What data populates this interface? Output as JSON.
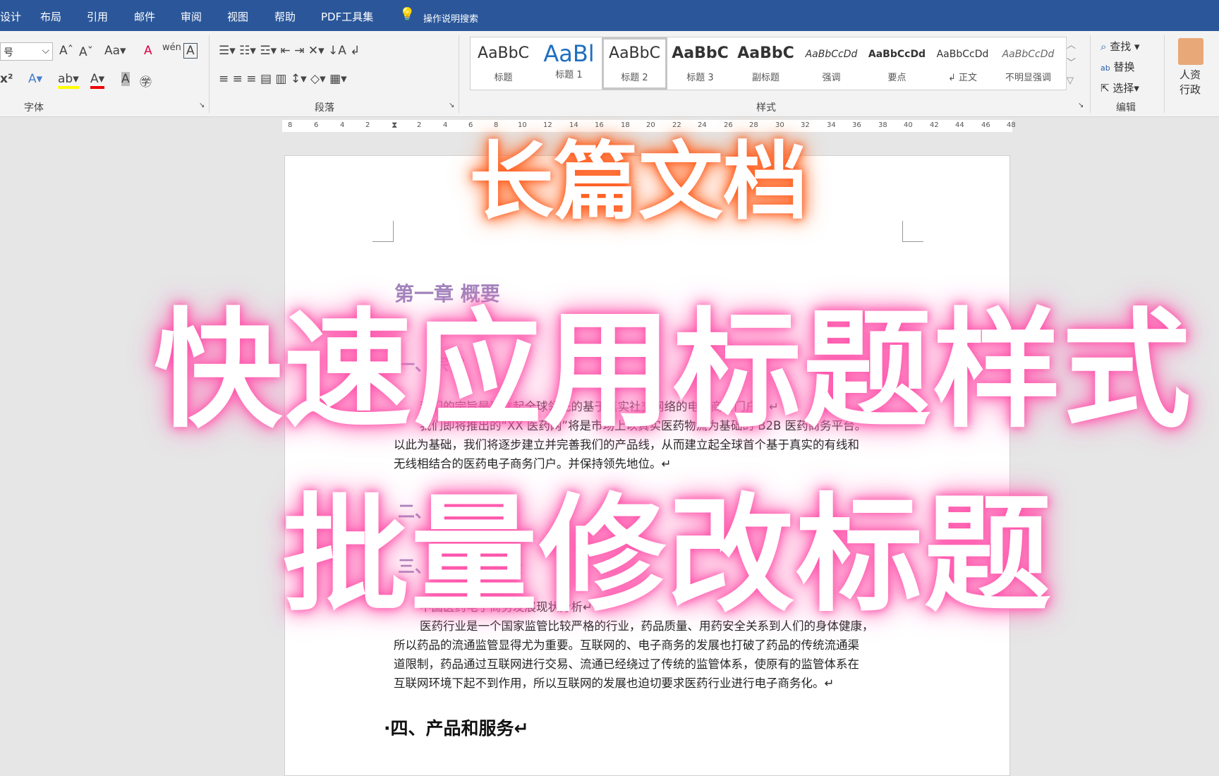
{
  "tabs": [
    "设计",
    "布局",
    "引用",
    "邮件",
    "审阅",
    "视图",
    "帮助",
    "PDF工具集",
    "操作说明搜索"
  ],
  "font_group": {
    "size_value": "号",
    "label": "字体"
  },
  "paragraph_group": {
    "label": "段落"
  },
  "styles_group": {
    "label": "样式",
    "items": [
      {
        "preview": "AaBbC",
        "name": "标题"
      },
      {
        "preview": "AaBl",
        "name": "标题 1"
      },
      {
        "preview": "AaBbC",
        "name": "标题 2"
      },
      {
        "preview": "AaBbC",
        "name": "标题 3"
      },
      {
        "preview": "AaBbC",
        "name": "副标题"
      },
      {
        "preview": "AaBbCcDd",
        "name": "强调"
      },
      {
        "preview": "AaBbCcDd",
        "name": "要点"
      },
      {
        "preview": "AaBbCcDd",
        "name": "↲ 正文"
      },
      {
        "preview": "AaBbCcDd",
        "name": "不明显强调"
      }
    ]
  },
  "editing_group": {
    "label": "编辑",
    "find": "查找",
    "replace": "替换",
    "select": "选择"
  },
  "addin": {
    "label1": "人资",
    "label2": "行政"
  },
  "ruler": [
    "8",
    "6",
    "4",
    "2",
    "2",
    "4",
    "6",
    "8",
    "10",
    "12",
    "14",
    "16",
    "18",
    "20",
    "22",
    "24",
    "26",
    "28",
    "30",
    "32",
    "34",
    "36",
    "38",
    "40",
    "42",
    "44",
    "46",
    "48"
  ],
  "document": {
    "heading_faded": [
      "第一章 概要",
      "一、宗旨",
      "二、",
      "三、 与公司愿景"
    ],
    "para1": [
      "我们的宗旨是建立起全球领先的基于真实社交网络的电子商务门户。↵",
      "我们即将推出的“XX 医药网”将是市场上以真实医药物流为基础的 B2B 医药商务平台。",
      "以此为基础，我们将逐步建立并完善我们的产品线，从而建立起全球首个基于真实的有线和",
      "无线相结合的医药电子商务门户。并保持领先地位。↵"
    ],
    "para2": [
      "中国医药电子商务发展现状分析↵",
      "医药行业是一个国家监管比较严格的行业，药品质量、用药安全关系到人们的身体健康，",
      "所以药品的流通监管显得尤为重要。互联网的、电子商务的发展也打破了药品的传统流通渠",
      "道限制，药品通过互联网进行交易、流通已经绕过了传统的监管体系，使原有的监管体系在",
      "互联网环境下起不到作用，所以互联网的发展也迫切要求医药行业进行电子商务化。↵"
    ],
    "heading4": "·四、产品和服务↵"
  },
  "overlay": {
    "line1": "长篇文档",
    "line2": "快速应用标题样式",
    "line3": "批量修改标题"
  }
}
